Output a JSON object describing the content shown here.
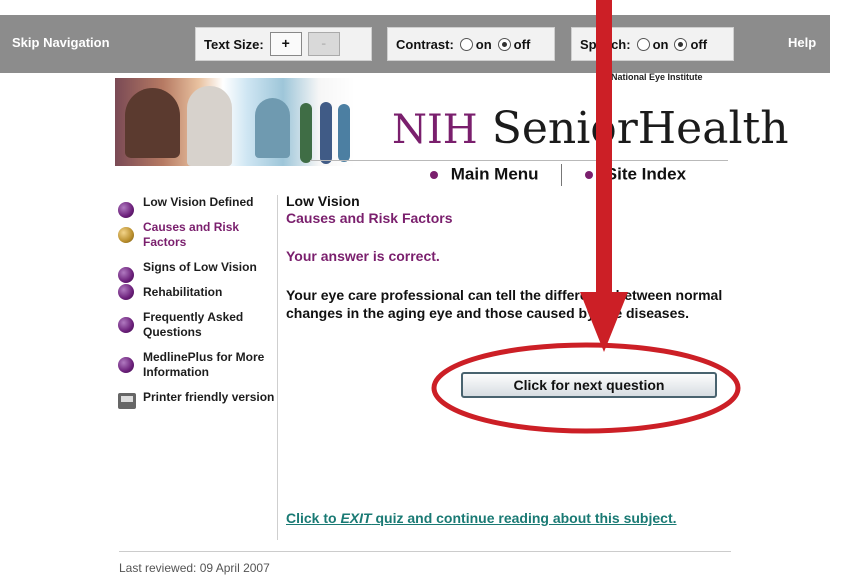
{
  "topbar": {
    "skip": "Skip Navigation",
    "text_size_label": "Text Size:",
    "text_plus": "+",
    "text_minus": "-",
    "contrast_label": "Contrast:",
    "contrast_on": "on",
    "contrast_off": "off",
    "speech_label": "Speech:",
    "speech_on": "on",
    "speech_off": "off",
    "help": "Help"
  },
  "header": {
    "nei": "National Eye Institute",
    "logo_prefix": "NIH",
    "logo_main": "SeniorHealth",
    "main_menu": "Main Menu",
    "site_index": "Site Index"
  },
  "sidebar": {
    "items": [
      {
        "label": "Low Vision Defined"
      },
      {
        "label": "Causes and Risk Factors"
      },
      {
        "label": "Signs of Low Vision"
      },
      {
        "label": "Rehabilitation"
      },
      {
        "label": "Frequently Asked Questions"
      },
      {
        "label": "MedlinePlus for More Information"
      },
      {
        "label": "Printer friendly version"
      }
    ]
  },
  "main": {
    "title": "Low Vision",
    "subtitle": "Causes and Risk Factors",
    "answer": "Your answer is correct.",
    "explanation": "Your eye care professional can tell the difference between normal changes in the aging eye and those caused by eye diseases.",
    "next_button": "Click for next question",
    "exit_text_prefix": "Click to ",
    "exit_text_em": "EXIT",
    "exit_text_suffix": " quiz and continue reading about this subject."
  },
  "footer": {
    "last_updated": "Last reviewed: 09 April 2007"
  },
  "colors": {
    "accent": "#7a1f6d",
    "annotation": "#cc1f26",
    "exit_link": "#1a7a74"
  }
}
